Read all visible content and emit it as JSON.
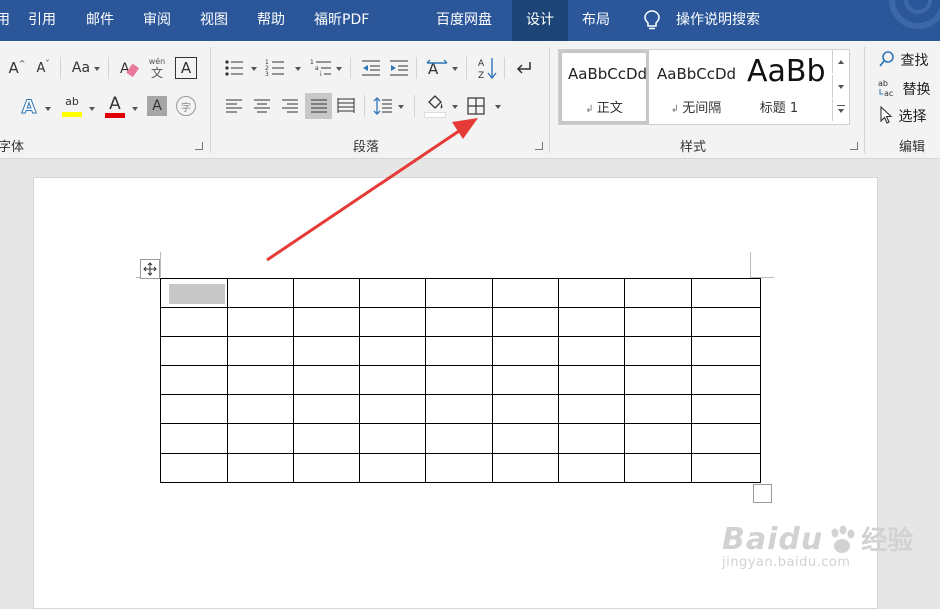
{
  "menubar": {
    "tabs": [
      {
        "label": "引用"
      },
      {
        "label": "邮件"
      },
      {
        "label": "审阅"
      },
      {
        "label": "视图"
      },
      {
        "label": "帮助"
      },
      {
        "label": "福昕PDF"
      },
      {
        "label": "百度网盘"
      },
      {
        "label": "设计"
      },
      {
        "label": "布局"
      }
    ],
    "search_label": "操作说明搜索"
  },
  "ribbon": {
    "groups": {
      "font_label": "字体",
      "paragraph_label": "段落",
      "styles_label": "样式",
      "editing_label": "编辑"
    },
    "font": {
      "change_case": "Aa",
      "phonetic": "wén",
      "phonetic_char": "文",
      "enclose_char": "字",
      "grow": "A",
      "shrink": "A"
    },
    "styles": [
      {
        "sample": "AaBbCcDd",
        "name": "正文"
      },
      {
        "sample": "AaBbCcDd",
        "name": "无间隔"
      },
      {
        "sample": "AaBb",
        "name": "标题 1"
      }
    ],
    "editing": {
      "find": "查找",
      "replace": "替换",
      "select": "选择"
    }
  },
  "document": {
    "table": {
      "rows": 7,
      "cols": 9
    }
  },
  "watermark": {
    "brand": "Baidu",
    "product": "经验",
    "url": "jingyan.baidu.com"
  },
  "colors": {
    "title_bar": "#2b579a",
    "highlight": "#ffff00",
    "font_color": "#ff0000",
    "arrow": "#e53a35"
  }
}
